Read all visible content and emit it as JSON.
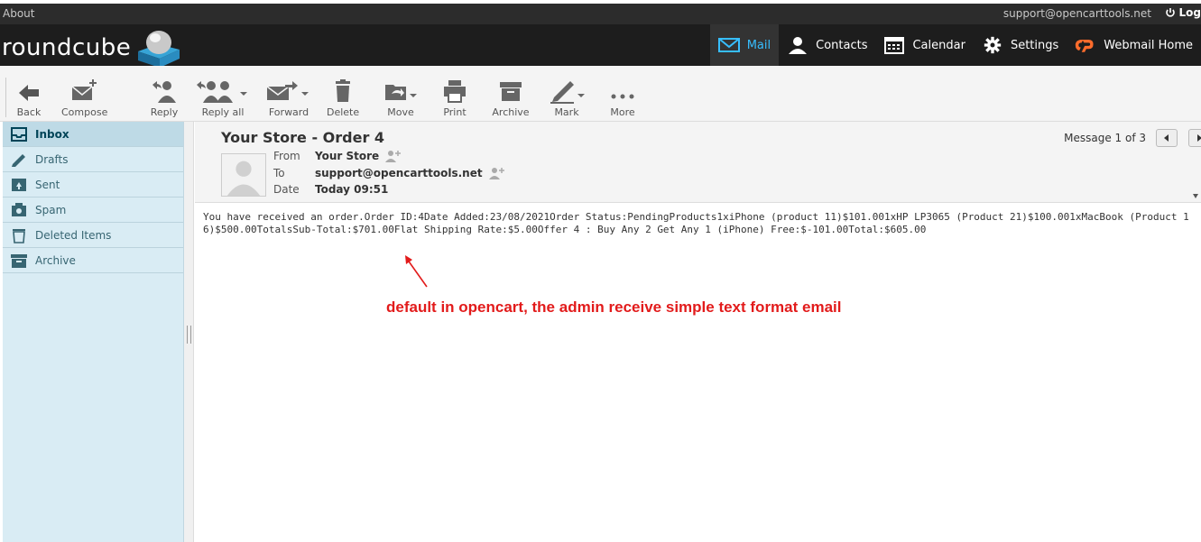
{
  "topbar": {
    "about": "About",
    "user_email": "support@opencarttools.net",
    "logout": "Log"
  },
  "brand": {
    "name": "roundcube"
  },
  "nav": [
    {
      "label": "Mail",
      "icon": "mail-icon",
      "active": true
    },
    {
      "label": "Contacts",
      "icon": "person-icon"
    },
    {
      "label": "Calendar",
      "icon": "calendar-icon"
    },
    {
      "label": "Settings",
      "icon": "gear-icon"
    },
    {
      "label": "Webmail Home",
      "icon": "cpanel-icon"
    }
  ],
  "toolbar": {
    "back": "Back",
    "compose": "Compose",
    "reply": "Reply",
    "reply_all": "Reply all",
    "forward": "Forward",
    "delete": "Delete",
    "move": "Move",
    "print": "Print",
    "archive": "Archive",
    "mark": "Mark",
    "more": "More"
  },
  "folders": [
    {
      "label": "Inbox",
      "icon": "inbox-icon",
      "active": true
    },
    {
      "label": "Drafts",
      "icon": "pencil-icon"
    },
    {
      "label": "Sent",
      "icon": "sent-icon"
    },
    {
      "label": "Spam",
      "icon": "spam-icon"
    },
    {
      "label": "Deleted Items",
      "icon": "trash-icon"
    },
    {
      "label": "Archive",
      "icon": "archive-icon"
    }
  ],
  "message": {
    "subject": "Your Store - Order 4",
    "from_label": "From",
    "from": "Your Store",
    "to_label": "To",
    "to": "support@opencarttools.net",
    "date_label": "Date",
    "date": "Today 09:51",
    "counter": "Message 1 of 3",
    "body": "You have received an order.Order ID:4Date Added:23/08/2021Order Status:PendingProducts1xiPhone (product 11)$101.001xHP LP3065 (Product 21)$100.001xMacBook (Product 16)$500.00TotalsSub-Total:$701.00Flat Shipping Rate:$5.00Offer 4 : Buy Any 2 Get Any 1 (iPhone) Free:$-101.00Total:$605.00"
  },
  "annotation": {
    "text": "default in opencart, the admin receive simple text format email",
    "color": "#e21b1b"
  },
  "colors": {
    "accent": "#37beff",
    "header_bg": "#1d1d1d",
    "sidebar_bg": "#d9ecf4"
  }
}
